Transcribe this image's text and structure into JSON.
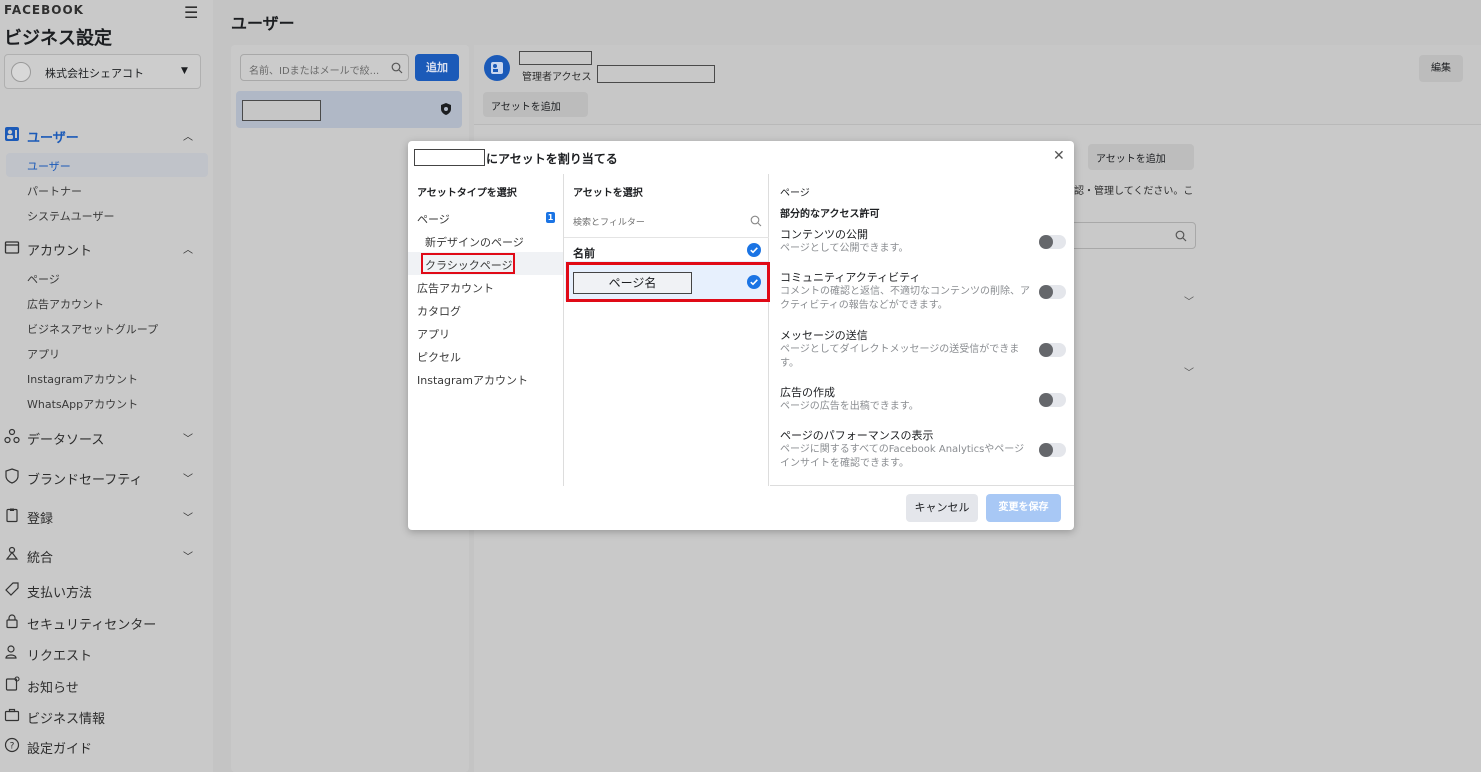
{
  "sidebar": {
    "brand": "FACEBOOK",
    "title": "ビジネス設定",
    "account_name": "株式会社シェアコト",
    "users_section": "ユーザー",
    "users_items": [
      "ユーザー",
      "パートナー",
      "システムユーザー"
    ],
    "accounts_section": "アカウント",
    "accounts_items": [
      "ページ",
      "広告アカウント",
      "ビジネスアセットグループ",
      "アプリ",
      "Instagramアカウント",
      "WhatsAppアカウント"
    ],
    "data_sources": "データソース",
    "brand_safety": "ブランドセーフティ",
    "registration": "登録",
    "integration": "統合",
    "payment": "支払い方法",
    "security_center": "セキュリティセンター",
    "requests": "リクエスト",
    "notifications": "お知らせ",
    "business_info": "ビジネス情報",
    "setup_guide": "設定ガイド"
  },
  "header": {
    "page_title": "ユーザー"
  },
  "user_list": {
    "search_placeholder": "名前、IDまたはメールで絞...",
    "add_label": "追加"
  },
  "detail": {
    "access_label": "管理者アクセス",
    "add_asset_label": "アセットを追加",
    "edit_label": "編集",
    "add_asset_label2": "アセットを追加",
    "partial_text": "認・管理してください。こ"
  },
  "modal": {
    "title": "にアセットを割り当てる",
    "col1_header": "アセットタイプを選択",
    "col1_items": {
      "page": "ページ",
      "page_badge": "1",
      "new_design": "新デザインのページ",
      "classic": "クラシックページ",
      "ad_account": "広告アカウント",
      "catalog": "カタログ",
      "app": "アプリ",
      "pixel": "ピクセル",
      "instagram": "Instagramアカウント"
    },
    "col2_header": "アセットを選択",
    "col2_search": "検索とフィルター",
    "col2_name_header": "名前",
    "col2_page_name": "ページ名",
    "col3_header": "ページ",
    "col3_partial": "部分的なアクセス許可",
    "permissions": [
      {
        "title": "コンテンツの公開",
        "desc": "ページとして公開できます。"
      },
      {
        "title": "コミュニティアクティビティ",
        "desc": "コメントの確認と返信、不適切なコンテンツの削除、アクティビティの報告などができます。"
      },
      {
        "title": "メッセージの送信",
        "desc": "ページとしてダイレクトメッセージの送受信ができます。"
      },
      {
        "title": "広告の作成",
        "desc": "ページの広告を出稿できます。"
      },
      {
        "title": "ページのパフォーマンスの表示",
        "desc": "ページに関するすべてのFacebook Analyticsやページインサイトを確認できます。"
      }
    ],
    "cancel_label": "キャンセル",
    "save_label": "変更を保存"
  },
  "colors": {
    "accent": "#1b5ab8",
    "highlight_red": "#e00a17",
    "toggle_off": "#65676b"
  }
}
